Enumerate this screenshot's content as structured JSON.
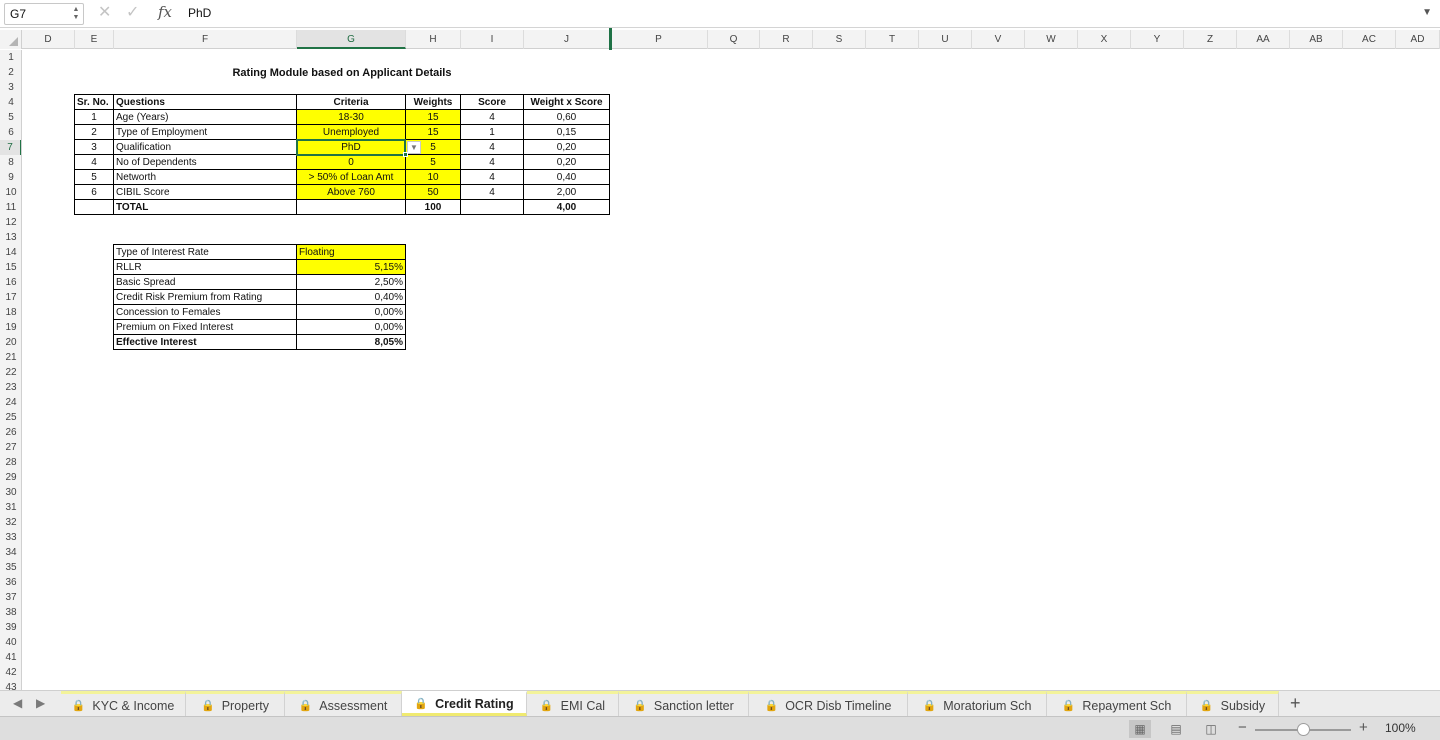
{
  "formula_bar": {
    "name_box": "G7",
    "fx_label": "fx",
    "cancel_icon": "✕",
    "confirm_icon": "✓",
    "formula": "PhD"
  },
  "columns": [
    "D",
    "E",
    "F",
    "G",
    "H",
    "I",
    "J",
    "P",
    "Q",
    "R",
    "S",
    "T",
    "U",
    "V",
    "W",
    "X",
    "Y",
    "Z",
    "AA",
    "AB",
    "AC",
    "AD"
  ],
  "selected_column": "G",
  "rows": [
    "1",
    "2",
    "3",
    "4",
    "5",
    "6",
    "7",
    "8",
    "9",
    "10",
    "11",
    "12",
    "13",
    "14",
    "15",
    "16",
    "17",
    "18",
    "19",
    "20",
    "21",
    "22",
    "23",
    "24",
    "25",
    "26",
    "27",
    "28",
    "29",
    "30",
    "31",
    "32",
    "33",
    "34",
    "35",
    "36",
    "37",
    "38",
    "39",
    "40",
    "41",
    "42",
    "43"
  ],
  "selected_row": "7",
  "sheet": {
    "title": "Rating Module based on Applicant Details",
    "rating_table": {
      "headers": [
        "Sr. No.",
        "Questions",
        "Criteria",
        "Weights",
        "Score",
        "Weight x Score"
      ],
      "rows": [
        [
          "1",
          "Age (Years)",
          "18-30",
          "15",
          "4",
          "0,60"
        ],
        [
          "2",
          "Type of Employment",
          "Unemployed",
          "15",
          "1",
          "0,15"
        ],
        [
          "3",
          "Qualification",
          "PhD",
          "5",
          "4",
          "0,20"
        ],
        [
          "4",
          "No of Dependents",
          "0",
          "5",
          "4",
          "0,20"
        ],
        [
          "5",
          "Networth",
          "> 50% of Loan Amt",
          "10",
          "4",
          "0,40"
        ],
        [
          "6",
          "CIBIL Score",
          "Above 760",
          "50",
          "4",
          "2,00"
        ]
      ],
      "total": [
        "",
        "TOTAL",
        "",
        "100",
        "",
        "4,00"
      ]
    },
    "interest_table": {
      "rows": [
        [
          "Type of Interest Rate",
          "Floating"
        ],
        [
          "RLLR",
          "5,15%"
        ],
        [
          "Basic Spread",
          "2,50%"
        ],
        [
          "Credit Risk Premium from Rating",
          "0,40%"
        ],
        [
          "Concession to Females",
          "0,00%"
        ],
        [
          "Premium on Fixed Interest",
          "0,00%"
        ],
        [
          "Effective Interest",
          "8,05%"
        ]
      ]
    }
  },
  "tabs": [
    {
      "label": "KYC & Income",
      "locked": true
    },
    {
      "label": "Property",
      "locked": true
    },
    {
      "label": "Assessment",
      "locked": true
    },
    {
      "label": "Credit Rating",
      "locked": true,
      "active": true
    },
    {
      "label": "EMI Cal",
      "locked": true
    },
    {
      "label": "Sanction letter",
      "locked": true
    },
    {
      "label": "OCR Disb Timeline",
      "locked": true
    },
    {
      "label": "Moratorium Sch",
      "locked": true
    },
    {
      "label": "Repayment Sch",
      "locked": true
    },
    {
      "label": "Subsidy",
      "locked": true
    }
  ],
  "add_tab_label": "+",
  "status_bar": {
    "zoom": "100%"
  },
  "colors": {
    "highlight": "#ffff00",
    "selection": "#217346",
    "tab_accent": "#f0ea70"
  }
}
